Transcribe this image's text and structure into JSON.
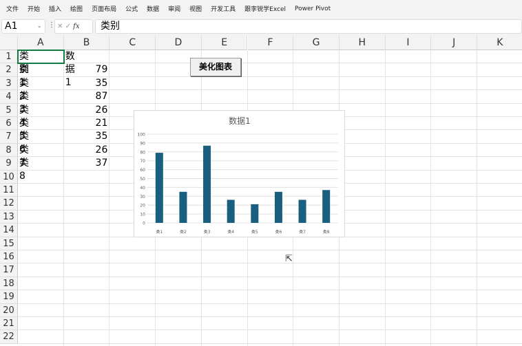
{
  "menu": [
    "文件",
    "开始",
    "插入",
    "绘图",
    "页面布局",
    "公式",
    "数据",
    "审阅",
    "视图",
    "开发工具",
    "跟李锐学Excel",
    "Power Pivot"
  ],
  "name_box": "A1",
  "formula_value": "类别",
  "columns": [
    "A",
    "B",
    "C",
    "D",
    "E",
    "F",
    "G",
    "H",
    "I",
    "J",
    "K"
  ],
  "rows": [
    "1",
    "2",
    "3",
    "4",
    "5",
    "6",
    "7",
    "8",
    "9",
    "10",
    "11",
    "12",
    "13",
    "14",
    "15",
    "16",
    "17",
    "18",
    "19",
    "20",
    "21",
    "22"
  ],
  "table": {
    "headers": [
      "类别",
      "数据1"
    ],
    "rows": [
      [
        "类1",
        "79"
      ],
      [
        "类2",
        "35"
      ],
      [
        "类3",
        "87"
      ],
      [
        "类4",
        "26"
      ],
      [
        "类5",
        "21"
      ],
      [
        "类6",
        "35"
      ],
      [
        "类7",
        "26"
      ],
      [
        "类8",
        "37"
      ]
    ]
  },
  "button_label": "美化图表",
  "chart_data": {
    "type": "bar",
    "title": "数据1",
    "categories": [
      "类1",
      "类2",
      "类3",
      "类4",
      "类5",
      "类6",
      "类7",
      "类8"
    ],
    "values": [
      79,
      35,
      87,
      26,
      21,
      35,
      26,
      37
    ],
    "ylim": [
      0,
      100
    ],
    "yticks": [
      0,
      10,
      20,
      30,
      40,
      50,
      60,
      70,
      80,
      90,
      100
    ],
    "grid": true,
    "bar_color": "#1a5e80"
  }
}
